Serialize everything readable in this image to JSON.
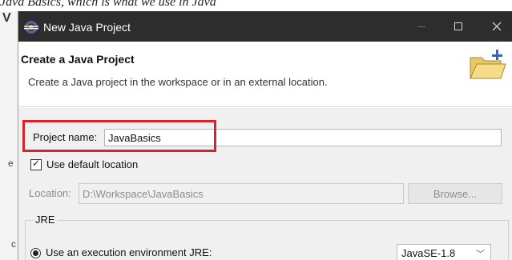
{
  "background": {
    "top_text": "Java Basics, which is what we use in Java",
    "left_marks": [
      "V",
      "e",
      "c"
    ]
  },
  "window": {
    "title": "New Java Project",
    "controls": {
      "minimize": "—",
      "maximize": "□",
      "close": "✕"
    }
  },
  "header": {
    "title": "Create a Java Project",
    "description": "Create a Java project in the workspace or in an external location."
  },
  "form": {
    "project_name_label": "Project name:",
    "project_name_value": "JavaBasics",
    "use_default_location_label": "Use default location",
    "use_default_location_checked": true,
    "location_label": "Location:",
    "location_value": "D:\\Workspace\\JavaBasics",
    "browse_label": "Browse..."
  },
  "jre": {
    "group_label": "JRE",
    "option_label": "Use an execution environment JRE:",
    "selected_env": "JavaSE-1.8"
  },
  "icons": [
    "eclipse-app-icon",
    "folder-icon",
    "chevron-down-icon"
  ],
  "colors": {
    "titlebar": "#2d2d2d",
    "highlight": "#d8232a",
    "dialog_bg": "#f0f0f0"
  }
}
